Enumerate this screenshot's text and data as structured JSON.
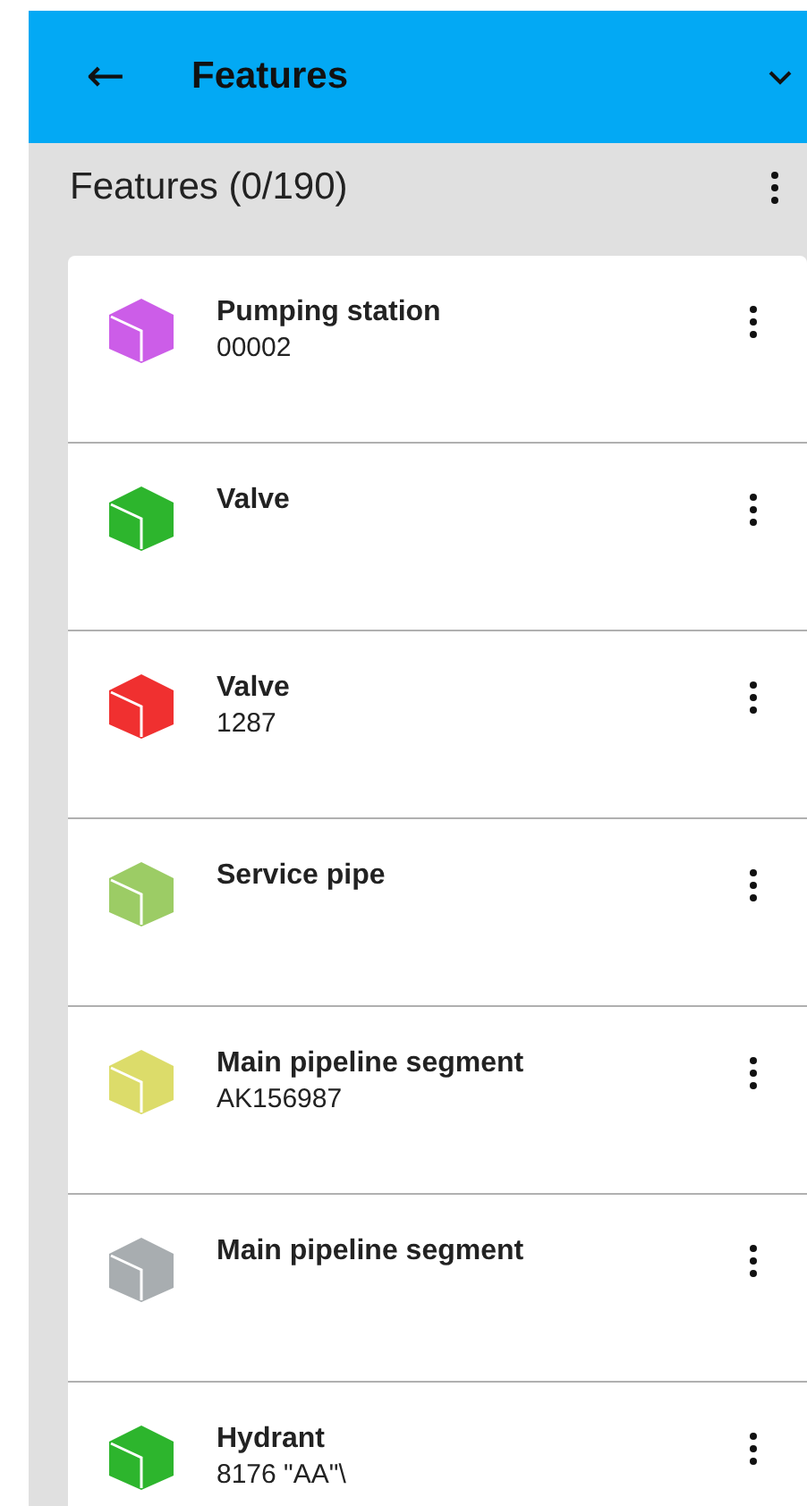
{
  "app_bar": {
    "back_icon": "←",
    "title": "Features"
  },
  "list_header": {
    "title": "Features (0/190)"
  },
  "features": [
    {
      "name": "Pumping station",
      "code": "00002",
      "color": "#cc5de8"
    },
    {
      "name": "Valve",
      "color": "#2db52d"
    },
    {
      "name": "Valve",
      "code": "1287",
      "color": "#f03030"
    },
    {
      "name": "Service pipe",
      "color": "#9ccc65"
    },
    {
      "name": "Main pipeline segment",
      "code": "AK156987",
      "color": "#dcdc6a"
    },
    {
      "name": "Main pipeline segment",
      "color": "#a8adb0"
    },
    {
      "name": "Hydrant",
      "code": "8176 \"AA\"\\",
      "color": "#2db52d"
    }
  ]
}
